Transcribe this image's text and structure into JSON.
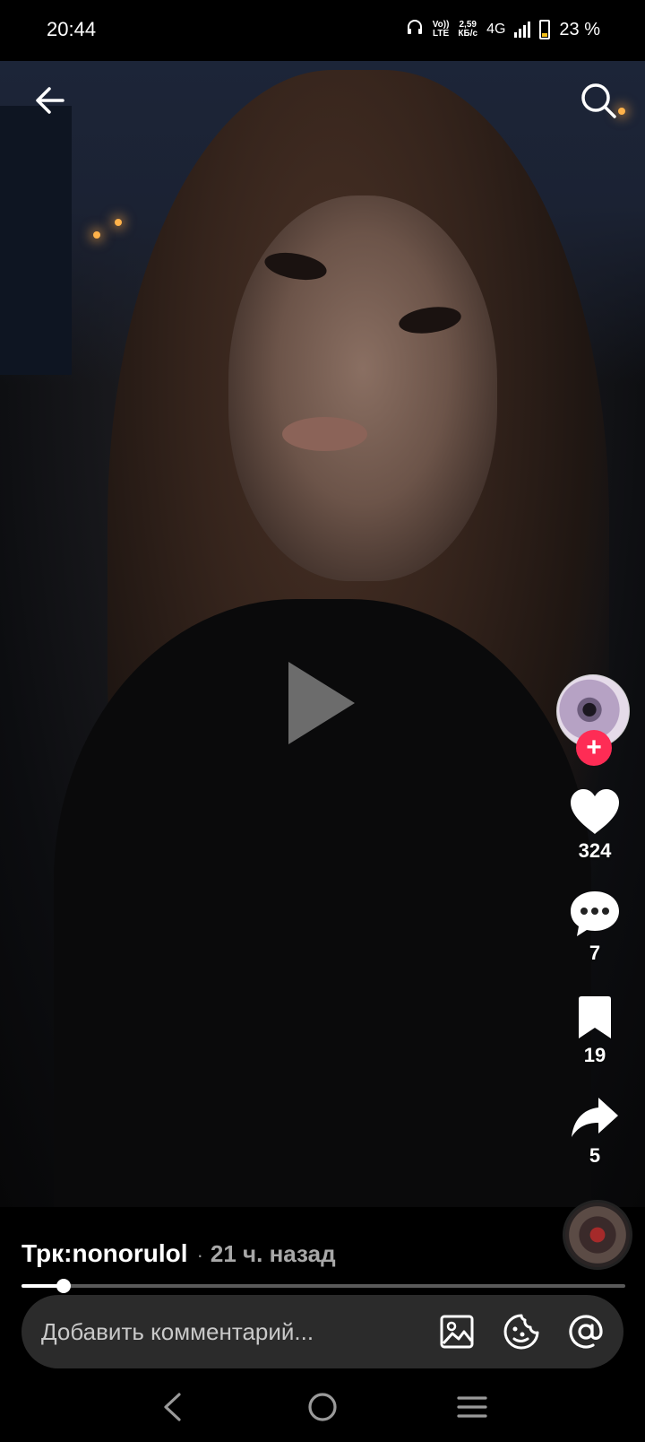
{
  "status_bar": {
    "time": "20:44",
    "volte_top": "Vo))",
    "volte_bottom": "LTE",
    "speed_top": "2,59",
    "speed_bottom": "КБ/с",
    "network": "4G",
    "battery_percent": "23 %",
    "battery_level": 0.23,
    "icons": [
      "headphones-icon",
      "signal-icon",
      "battery-icon"
    ]
  },
  "video": {
    "state": "paused",
    "top_left_icon": "back-arrow-icon",
    "top_right_icon": "search-icon",
    "center_icon": "play-icon"
  },
  "actions": {
    "follow_icon": "plus-icon",
    "likes": "324",
    "comments": "7",
    "bookmarks": "19",
    "shares": "5"
  },
  "info": {
    "author": "Трк:nonorulol",
    "separator": "·",
    "time_ago": "21 ч. назад",
    "progress": 0.07
  },
  "comment_bar": {
    "placeholder": "Добавить комментарий...",
    "icons": [
      "image-icon",
      "emoji-icon",
      "mention-icon"
    ]
  },
  "colors": {
    "accent": "#fe2c55",
    "battery_low": "#f5c018",
    "comment_bar_bg": "#2b2b2b"
  }
}
